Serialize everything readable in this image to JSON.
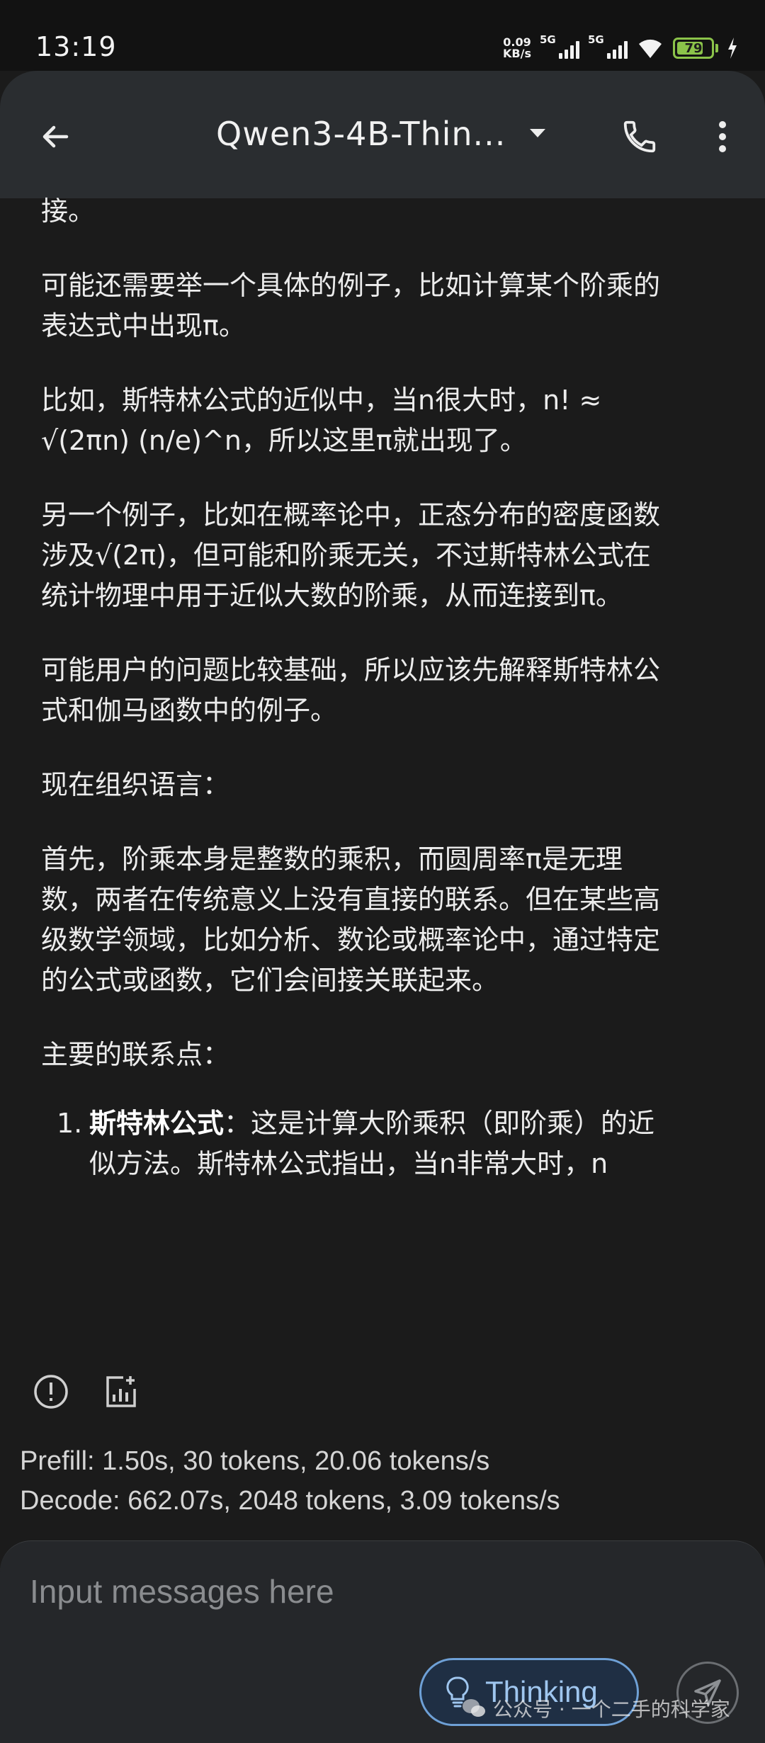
{
  "status": {
    "time": "13:19",
    "net_speed_value": "0.09",
    "net_speed_unit": "KB/s",
    "signal1_label": "5G",
    "signal2_label": "5G",
    "battery": "79",
    "battery_fraction": 0.79
  },
  "header": {
    "title": "Qwen3-4B-Thin..."
  },
  "message": {
    "paragraphs": [
      "接。",
      "可能还需要举一个具体的例子，比如计算某个阶乘的表达式中出现π。",
      "比如，斯特林公式的近似中，当n很大时，n! ≈ √(2πn) (n/e)^n，所以这里π就出现了。",
      "另一个例子，比如在概率论中，正态分布的密度函数涉及√(2π)，但可能和阶乘无关，不过斯特林公式在统计物理中用于近似大数的阶乘，从而连接到π。",
      "可能用户的问题比较基础，所以应该先解释斯特林公式和伽马函数中的例子。",
      "现在组织语言：",
      "首先，阶乘本身是整数的乘积，而圆周率π是无理数，两者在传统意义上没有直接的联系。但在某些高级数学领域，比如分析、数论或概率论中，通过特定的公式或函数，它们会间接关联起来。",
      "主要的联系点："
    ],
    "list_items": [
      {
        "number": "1.",
        "bold": "斯特林公式",
        "text": "：这是计算大阶乘积（即阶乘）的近似方法。斯特林公式指出，当n非常大时，n"
      }
    ]
  },
  "stats": {
    "prefill": "Prefill: 1.50s, 30 tokens, 20.06 tokens/s",
    "decode": "Decode: 662.07s, 2048 tokens, 3.09 tokens/s"
  },
  "composer": {
    "placeholder": "Input messages here",
    "thinking_label": "Thinking"
  },
  "watermark": "公众号 · 一个二手的科学家",
  "colors": {
    "background": "#1b1b1b",
    "appbar": "#2a2d30",
    "accent": "#9fc6ef",
    "battery": "#8bc34a"
  },
  "icons": [
    "back-arrow-icon",
    "dropdown-icon",
    "phone-icon",
    "more-vert-icon",
    "info-icon",
    "stats-icon",
    "lightbulb-icon",
    "send-icon",
    "wechat-icon"
  ]
}
